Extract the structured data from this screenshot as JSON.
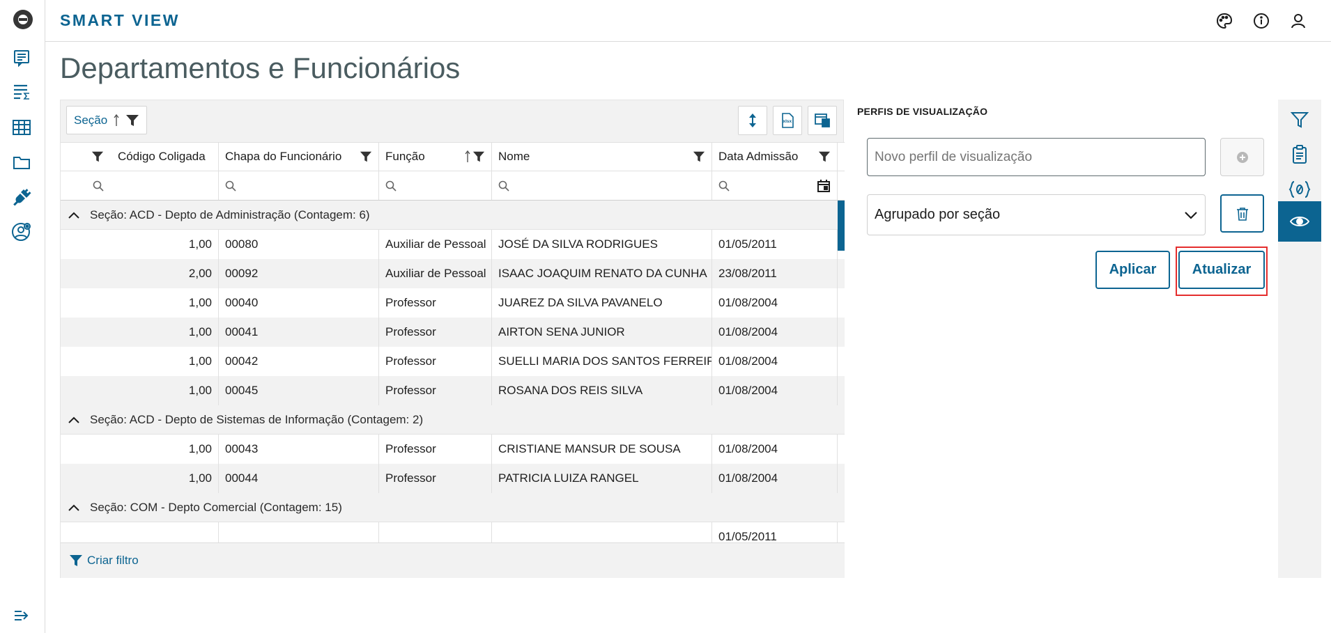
{
  "app": {
    "brand": "SMART VIEW"
  },
  "page": {
    "title": "Departamentos e Funcionários"
  },
  "toolbar": {
    "group_label": "Seção"
  },
  "columns": [
    {
      "label": "Código Coligada"
    },
    {
      "label": "Chapa do Funcionário"
    },
    {
      "label": "Função"
    },
    {
      "label": "Nome"
    },
    {
      "label": "Data Admissão"
    }
  ],
  "groups": [
    {
      "label": "Seção: ACD - Depto de Administração (Contagem: 6)",
      "rows": [
        {
          "codigo": "1,00",
          "chapa": "00080",
          "funcao": "Auxiliar de Pessoal",
          "nome": "JOSÉ DA SILVA RODRIGUES",
          "data": "01/05/2011"
        },
        {
          "codigo": "2,00",
          "chapa": "00092",
          "funcao": "Auxiliar de Pessoal",
          "nome": "ISAAC JOAQUIM RENATO DA CUNHA",
          "data": "23/08/2011"
        },
        {
          "codigo": "1,00",
          "chapa": "00040",
          "funcao": "Professor",
          "nome": "JUAREZ DA SILVA PAVANELO",
          "data": "01/08/2004"
        },
        {
          "codigo": "1,00",
          "chapa": "00041",
          "funcao": "Professor",
          "nome": "AIRTON SENA JUNIOR",
          "data": "01/08/2004"
        },
        {
          "codigo": "1,00",
          "chapa": "00042",
          "funcao": "Professor",
          "nome": "SUELLI MARIA DOS SANTOS FERREIRA",
          "data": "01/08/2004"
        },
        {
          "codigo": "1,00",
          "chapa": "00045",
          "funcao": "Professor",
          "nome": "ROSANA DOS REIS SILVA",
          "data": "01/08/2004"
        }
      ]
    },
    {
      "label": "Seção: ACD - Depto de Sistemas de Informação (Contagem: 2)",
      "rows": [
        {
          "codigo": "1,00",
          "chapa": "00043",
          "funcao": "Professor",
          "nome": "CRISTIANE MANSUR DE SOUSA",
          "data": "01/08/2004"
        },
        {
          "codigo": "1,00",
          "chapa": "00044",
          "funcao": "Professor",
          "nome": "PATRICIA LUIZA RANGEL",
          "data": "01/08/2004"
        }
      ]
    },
    {
      "label": "Seção: COM - Depto Comercial (Contagem: 15)",
      "rows": [
        {
          "codigo": "",
          "chapa": "",
          "funcao": "",
          "nome": "",
          "data": "01/05/2011"
        }
      ]
    }
  ],
  "footer": {
    "create_filter": "Criar filtro"
  },
  "profiles": {
    "title": "PERFIS DE VISUALIZAÇÃO",
    "new_placeholder": "Novo perfil de visualização",
    "selected": "Agrupado por seção",
    "apply_label": "Aplicar",
    "update_label": "Atualizar"
  },
  "colors": {
    "accent": "#0c6491",
    "highlight": "#e52d2d",
    "title": "#4a5c60"
  }
}
